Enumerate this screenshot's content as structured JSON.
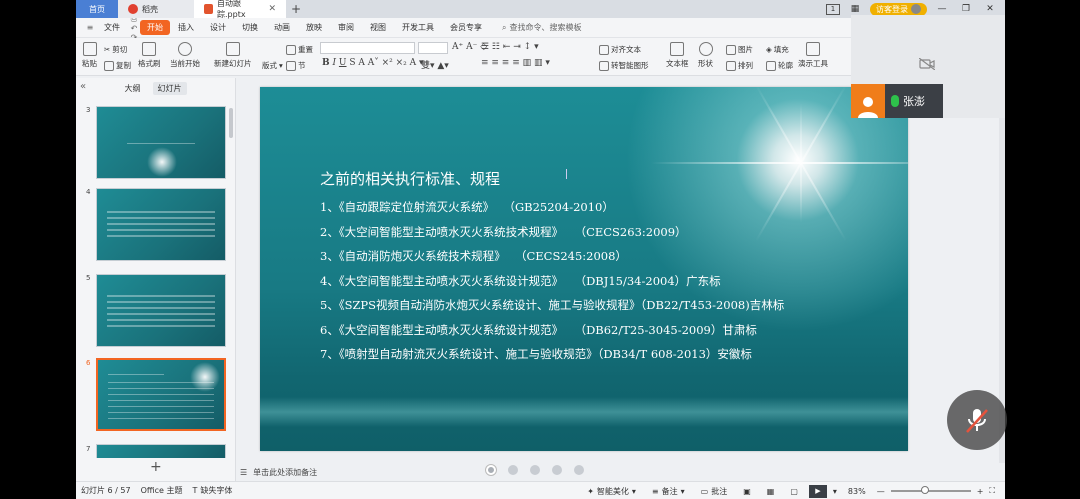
{
  "titlebar": {
    "tabs": [
      {
        "label": "首页"
      },
      {
        "label": "稻壳"
      },
      {
        "label": "自动跟踪.pptx"
      }
    ],
    "badge": "1",
    "login_label": "访客登录"
  },
  "menubar": {
    "file_label": "文件",
    "items": [
      "开始",
      "插入",
      "设计",
      "切换",
      "动画",
      "放映",
      "审阅",
      "视图",
      "开发工具",
      "会员专享"
    ],
    "active": "开始",
    "search_placeholder": "查找命令、搜索模板"
  },
  "ribbon": {
    "paste": "粘贴",
    "cut": "剪切",
    "copy": "复制",
    "format_painter": "格式刷",
    "from_current": "当前开始",
    "new_slide": "新建幻灯片",
    "layout": "版式",
    "section": "节",
    "reset": "重置",
    "text_box": "文本框",
    "shape": "形状",
    "arrange": "排列",
    "outline": "轮廓",
    "slideshow_tools": "演示工具",
    "picture": "图片",
    "fill": "填充",
    "align_text": "对齐文本",
    "smart_graphic": "转智能图形"
  },
  "left_panel": {
    "tabs": [
      "大纲",
      "幻灯片"
    ],
    "active_tab": "幻灯片",
    "thumbnails": [
      {
        "num": "3"
      },
      {
        "num": "4"
      },
      {
        "num": "5"
      },
      {
        "num": "6",
        "selected": true
      },
      {
        "num": "7"
      }
    ]
  },
  "slide": {
    "title": "之前的相关执行标准、规程",
    "items": [
      "1、《自动跟踪定位射流灭火系统》　 （GB25204-2010）",
      "2、《大空间智能型主动喷水灭火系统技术规程》　　（CECS263:2009）",
      "3、《自动消防炮灭火系统技术规程》　 （CECS245:2008）",
      "4、《大空间智能型主动喷水灭火系统设计规范》　　（DBJ15/34-2004）广东标",
      "5、《SZPS视频自动消防水炮灭火系统设计、施工与验收规程》（DB22/T453-2008)吉林标",
      "6、《大空间智能型主动喷水灭火系统设计规范》　　（DB62/T25-3045-2009）甘肃标",
      "7、《喷射型自动射流灭火系统设计、施工与验收规范》（DB34/T 608-2013）安徽标"
    ]
  },
  "notes": {
    "placeholder": "单击此处添加备注"
  },
  "statusbar": {
    "slide_counter": "幻灯片 6 / 57",
    "theme": "Office 主题",
    "missing_font": "缺失字体",
    "smart_beautify": "智能美化",
    "notes": "备注",
    "comment": "批注",
    "zoom": "83%"
  },
  "meeting": {
    "speaker_name": "张澎"
  },
  "colors": {
    "accent": "#f26522",
    "slide_teal": "#187a84",
    "home_tab": "#4a7fd4"
  }
}
